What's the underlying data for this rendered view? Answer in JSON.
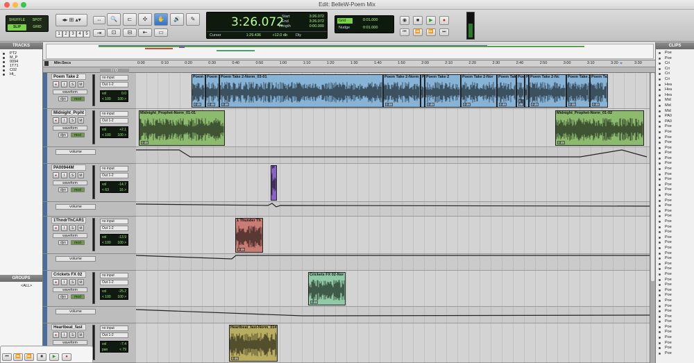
{
  "window": {
    "title": "Edit: BelleW-Poem Mix"
  },
  "toolbar": {
    "modes": [
      "SHUFFLE",
      "SPOT",
      "SLIP",
      "GRID"
    ],
    "zoom_presets": [
      "1",
      "2",
      "3",
      "4",
      "5"
    ]
  },
  "counter": {
    "main": "3:26.072",
    "start_label": "Start",
    "start_value": "3:26.072",
    "end_label": "End",
    "end_value": "3:26.072",
    "length_label": "Length",
    "length_value": "0:00.000",
    "cursor_label": "Cursor",
    "cursor_value": "1:29.436",
    "db_value": "+12.0 db",
    "dly_label": "Dly"
  },
  "grid": {
    "grid_label": "Grid",
    "grid_value": "0:01.000",
    "nudge_label": "Nudge",
    "nudge_value": "0:01.000"
  },
  "panels": {
    "tracks_title": "TRACKS",
    "groups_title": "GROUPS",
    "clips_title": "CLIPS",
    "all_group": "<ALL>"
  },
  "track_list": [
    "PT2",
    "M_P",
    "0094",
    "1T71",
    "C02",
    "Ht_"
  ],
  "ruler": {
    "label": "Min:Secs",
    "ticks": [
      "0:00",
      "0:10",
      "0:20",
      "0:30",
      "0:40",
      "0:50",
      "1:00",
      "1:10",
      "1:20",
      "1:30",
      "1:40",
      "1:50",
      "2:00",
      "2:10",
      "2:20",
      "2:30",
      "2:40",
      "2:50",
      "3:00",
      "3:10",
      "3:20",
      "3:30"
    ]
  },
  "io_header": "I / O",
  "tracks": [
    {
      "name": "Poem Take 2",
      "input": "no input",
      "output": "Out 1-2",
      "view": "waveform",
      "dyn": "dyn",
      "mod": "mod",
      "vol_label": "vol",
      "vol": "0.0",
      "pan_l": "< 100",
      "pan_r": "100 >",
      "clips": [
        {
          "name": "Poem",
          "gain": "0 dB"
        },
        {
          "name": "Poem",
          "gain": "0 dB"
        },
        {
          "name": "Poem Take 2-Norm_03-01",
          "gain": "0 dB"
        },
        {
          "name": "Poem Take 2-Norm_",
          "gain": "0 dB"
        },
        {
          "name": "Poe",
          "gain": ""
        },
        {
          "name": "Poem Take 2",
          "gain": "0 dB"
        },
        {
          "name": "Poem Take 2-Nor",
          "gain": "0 dB"
        },
        {
          "name": "Poem Take",
          "gain": "0 dB"
        },
        {
          "name": "Poem",
          "gain": "0 dB"
        },
        {
          "name": "P",
          "gain": ""
        },
        {
          "name": "Poem Take 2-Nc",
          "gain": "0 dB"
        },
        {
          "name": "Poem Take 2",
          "gain": "0 dB"
        },
        {
          "name": "Poem Take 2-N",
          "gain": "0 dB"
        }
      ]
    },
    {
      "name": "Midnight_Prpht",
      "input": "no input",
      "output": "Out 1-2",
      "view": "waveform",
      "dyn": "dyn",
      "mod": "mod",
      "vol_label": "vol",
      "vol": "+2.1",
      "pan_l": "< 100",
      "pan_r": "100 >",
      "auto_view": "volume",
      "clips": [
        {
          "name": "Midnight_Prophet-Norm_01-01",
          "gain": "0 dB"
        },
        {
          "name": "Midnight_Prophet-Norm_01-02",
          "gain": "0 dB"
        }
      ]
    },
    {
      "name": "PA00944M",
      "input": "no input",
      "output": "Out 1-2",
      "view": "waveform",
      "dyn": "dyn",
      "mod": "mod",
      "vol_label": "vol",
      "vol": "-14.7",
      "pan_l": "< 63",
      "pan_r": "16 >",
      "auto_view": "volume",
      "clips": [
        {
          "name": "P",
          "gain": ""
        }
      ]
    },
    {
      "name": "1ThndrThCAR1",
      "input": "no input",
      "output": "Out 1-2",
      "view": "waveform",
      "dyn": "dyn",
      "mod": "mod",
      "vol_label": "vol",
      "vol": "-13.9",
      "pan_l": "< 100",
      "pan_r": "100 >",
      "auto_view": "volume",
      "clips": [
        {
          "name": "1 Thunder Th",
          "gain": "0 dB"
        }
      ]
    },
    {
      "name": "Crickets FX 02",
      "input": "no input",
      "output": "Out 1-2",
      "view": "waveform",
      "dyn": "dyn",
      "mod": "mod",
      "vol_label": "vol",
      "vol": "-25.2",
      "pan_l": "< 100",
      "pan_r": "100 >",
      "auto_view": "volume",
      "clips": [
        {
          "name": "Crickets FX 02-Nor",
          "gain": "0 dB"
        }
      ]
    },
    {
      "name": "Heartbeat_fast",
      "input": "no input",
      "output": "Out 1-2",
      "view": "waveform",
      "dyn": "dyn",
      "mod": "mod",
      "vol_label": "vol",
      "vol": "-7.4",
      "pan_l": "pan",
      "pan_r": "< 79",
      "clips": [
        {
          "name": "Heartbeat_fast-Norm_01#",
          "gain": "0 dB"
        }
      ]
    }
  ],
  "clips_list": [
    "Poe",
    "Poe",
    "Cri",
    "Cri",
    "Cri",
    "Cri",
    "Hea",
    "Hea",
    "Hea",
    "Mid",
    "Mid",
    "Mid",
    "PA0",
    "PA0",
    "Poe",
    "Poe",
    "Poe",
    "Poe",
    "Poe",
    "Poe",
    "Poe",
    "Poe",
    "Poe",
    "Poe",
    "Poe",
    "Poe",
    "Poe",
    "Poe",
    "Poe",
    "Poe",
    "Poe",
    "Poe",
    "Poe",
    "Poe",
    "Poe",
    "Poe",
    "Poe",
    "Poe",
    "Poe",
    "Poe",
    "Poe",
    "Poe",
    "Poe",
    "Poe",
    "Poe",
    "Poe",
    "Poe",
    "Poe",
    "Poe",
    "Poe",
    "Poe",
    "Poe",
    "Poe",
    "Poe",
    "Poe",
    "Poe",
    "Poe",
    "Poe"
  ],
  "colors": {
    "poem": "#86b3d6",
    "midnight": "#8dbb6e",
    "pa": "#8b63c7",
    "thunder": "#c97c73",
    "crickets": "#8fc9a5",
    "heartbeat": "#b9ad62"
  }
}
